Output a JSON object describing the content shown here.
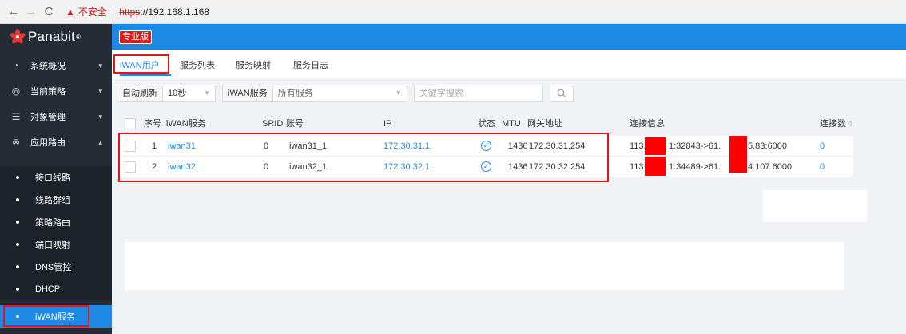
{
  "browser": {
    "back": "←",
    "forward": "→",
    "reload": "C",
    "security_label": "不安全",
    "url_scheme": "https",
    "url_rest": "://192.168.1.168"
  },
  "app": {
    "logo_text": "Panabit",
    "logo_reg": "®",
    "edition": "专业版",
    "accent_color": "#1e88e5",
    "sidebar_color": "#252c35"
  },
  "sidebar": {
    "items": [
      {
        "icon": "dashboard-icon",
        "label": "系统概况",
        "caret": "▾"
      },
      {
        "icon": "policy-icon",
        "label": "当前策略",
        "caret": "▾"
      },
      {
        "icon": "object-icon",
        "label": "对象管理",
        "caret": "▾"
      },
      {
        "icon": "routing-icon",
        "label": "应用路由",
        "caret": "▴"
      }
    ],
    "sub_items": [
      {
        "label": "接口线路"
      },
      {
        "label": "线路群组"
      },
      {
        "label": "策略路由"
      },
      {
        "label": "端口映射"
      },
      {
        "label": "DNS管控"
      },
      {
        "label": "DHCP"
      },
      {
        "label": "iWAN服务",
        "active": true
      }
    ]
  },
  "tabs": [
    {
      "label": "iWAN用户",
      "active": true
    },
    {
      "label": "服务列表"
    },
    {
      "label": "服务映射"
    },
    {
      "label": "服务日志"
    }
  ],
  "toolbar": {
    "auto_refresh_label": "自动刷新",
    "auto_refresh_value": "10秒",
    "service_label": "iWAN服务",
    "service_value": "所有服务",
    "search_placeholder": "关键字搜索"
  },
  "table": {
    "headers": {
      "index": "序号",
      "service": "iWAN服务",
      "srid": "SRID",
      "account": "账号",
      "ip": "IP",
      "status": "状态",
      "mtu": "MTU",
      "gateway": "网关地址",
      "conn_info": "连接信息",
      "conn_count": "连接数"
    },
    "rows": [
      {
        "index": "1",
        "service": "iwan31",
        "srid": "0",
        "account": "iwan31_1",
        "ip": "172.30.31.1",
        "status": "ok",
        "mtu": "1436",
        "gateway": "172.30.31.254",
        "conn_a": "113.1",
        "conn_b": "1:32843->61.",
        "conn_c": "5.83:6000",
        "conn_count": "0"
      },
      {
        "index": "2",
        "service": "iwan32",
        "srid": "0",
        "account": "iwan32_1",
        "ip": "172.30.32.1",
        "status": "ok",
        "mtu": "1436",
        "gateway": "172.30.32.254",
        "conn_a": "113.1",
        "conn_b": "1:34489->61.",
        "conn_c": "4.107:6000",
        "conn_count": "0"
      }
    ]
  }
}
